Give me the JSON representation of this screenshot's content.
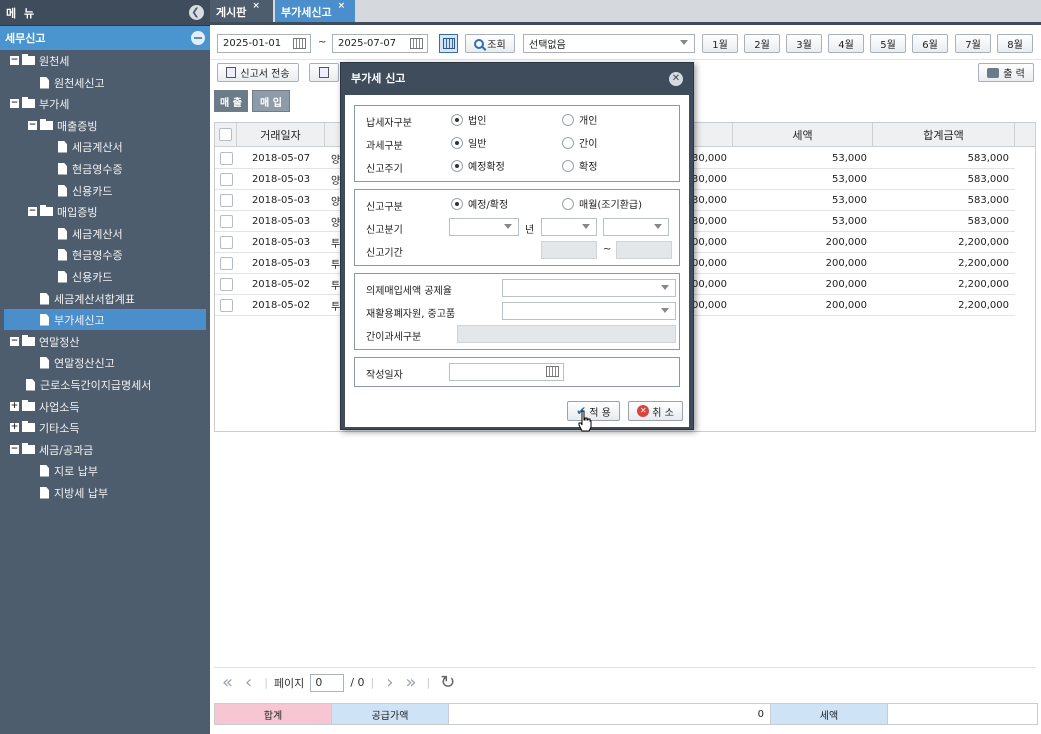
{
  "sidebar": {
    "title": "메 뉴",
    "section": "세무신고",
    "items": [
      {
        "label": "원천세",
        "kind": "folder",
        "toggle": "−"
      },
      {
        "label": "원천세신고",
        "kind": "doc"
      },
      {
        "label": "부가세",
        "kind": "folder",
        "toggle": "−"
      },
      {
        "label": "매출증빙",
        "kind": "folder",
        "toggle": "−"
      },
      {
        "label": "세금계산서",
        "kind": "doc"
      },
      {
        "label": "현금영수증",
        "kind": "doc"
      },
      {
        "label": "신용카드",
        "kind": "doc"
      },
      {
        "label": "매입증빙",
        "kind": "folder",
        "toggle": "−"
      },
      {
        "label": "세금계산서",
        "kind": "doc"
      },
      {
        "label": "현금영수증",
        "kind": "doc"
      },
      {
        "label": "신용카드",
        "kind": "doc"
      },
      {
        "label": "세금계산서합계표",
        "kind": "doc"
      },
      {
        "label": "부가세신고",
        "kind": "doc",
        "selected": true
      },
      {
        "label": "연말정산",
        "kind": "folder",
        "toggle": "−"
      },
      {
        "label": "연말정산신고",
        "kind": "doc"
      },
      {
        "label": "근로소득간이지급명세서",
        "kind": "doc"
      },
      {
        "label": "사업소득",
        "kind": "folder",
        "toggle": "+"
      },
      {
        "label": "기타소득",
        "kind": "folder",
        "toggle": "+"
      },
      {
        "label": "세금/공과금",
        "kind": "folder",
        "toggle": "−"
      },
      {
        "label": "지로 납부",
        "kind": "doc"
      },
      {
        "label": "지방세 납부",
        "kind": "doc"
      }
    ]
  },
  "tabs": [
    {
      "label": "게시판",
      "close": "×"
    },
    {
      "label": "부가세신고",
      "close": "×"
    }
  ],
  "toolbar": {
    "date_from": "2025-01-01",
    "tilde": "~",
    "date_to": "2025-07-07",
    "search_label": "조회",
    "select_value": "선택없음",
    "months": [
      "1월",
      "2월",
      "3월",
      "4월",
      "5월",
      "6월",
      "7월",
      "8월"
    ],
    "report_send_label": "신고서 전송",
    "print_label": "출 력"
  },
  "subtabs": [
    "매 출",
    "매 입"
  ],
  "grid": {
    "col_date": "거래일자",
    "col_tax": "세액",
    "col_total": "합계금액",
    "rows": [
      {
        "date": "2018-05-07",
        "c": "양",
        "supply": "530,000",
        "tax": "53,000",
        "total": "583,000"
      },
      {
        "date": "2018-05-03",
        "c": "양",
        "supply": "530,000",
        "tax": "53,000",
        "total": "583,000"
      },
      {
        "date": "2018-05-03",
        "c": "양",
        "supply": "530,000",
        "tax": "53,000",
        "total": "583,000"
      },
      {
        "date": "2018-05-03",
        "c": "양",
        "supply": "530,000",
        "tax": "53,000",
        "total": "583,000"
      },
      {
        "date": "2018-05-03",
        "c": "투",
        "supply": "2,000,000",
        "tax": "200,000",
        "total": "2,200,000"
      },
      {
        "date": "2018-05-03",
        "c": "투",
        "supply": "2,000,000",
        "tax": "200,000",
        "total": "2,200,000"
      },
      {
        "date": "2018-05-02",
        "c": "투",
        "supply": "2,000,000",
        "tax": "200,000",
        "total": "2,200,000"
      },
      {
        "date": "2018-05-02",
        "c": "투",
        "supply": "2,000,000",
        "tax": "200,000",
        "total": "2,200,000"
      }
    ]
  },
  "pager": {
    "label": "페이지",
    "page": "0",
    "total": "/ 0"
  },
  "summary": {
    "total_label": "합계",
    "supply_label": "공급가액",
    "supply_value": "0",
    "tax_label": "세액"
  },
  "dialog": {
    "title": "부가세 신고",
    "taxpayer_label": "납세자구분",
    "taxpayer_opt1": "법인",
    "taxpayer_opt2": "개인",
    "taxtype_label": "과세구분",
    "taxtype_opt1": "일반",
    "taxtype_opt2": "간이",
    "cycle_label": "신고주기",
    "cycle_opt1": "예정확정",
    "cycle_opt2": "확정",
    "reporttype_label": "신고구분",
    "reporttype_opt1": "예정/확정",
    "reporttype_opt2": "매월(조기환급)",
    "quarter_label": "신고분기",
    "year_suffix": "년",
    "period_label": "신고기간",
    "period_sep": "~",
    "deemed_label": "의제매입세액 공제율",
    "recycle_label": "재활용폐자원, 중고품",
    "simple_label": "간이과세구분",
    "written_label": "작성일자",
    "apply_label": "적 용",
    "cancel_label": "취 소"
  }
}
